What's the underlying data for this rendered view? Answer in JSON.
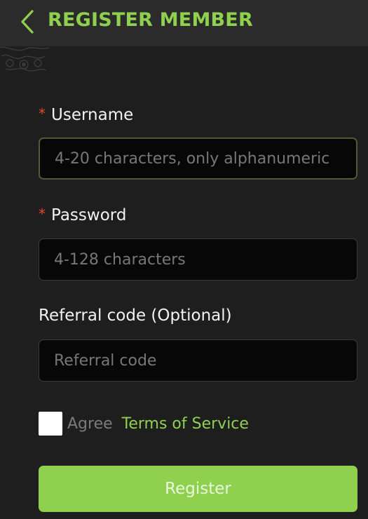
{
  "header": {
    "title": "REGISTER MEMBER",
    "back_icon": "chevron-left-icon"
  },
  "form": {
    "username": {
      "label": "Username",
      "required_mark": "*",
      "placeholder": "4-20 characters, only alphanumeric",
      "value": ""
    },
    "password": {
      "label": "Password",
      "required_mark": "*",
      "placeholder": "4-128 characters",
      "value": ""
    },
    "referral": {
      "label": "Referral code (Optional)",
      "placeholder": "Referral code",
      "value": ""
    },
    "agree": {
      "checked": false,
      "text": "Agree",
      "link": "Terms of Service"
    },
    "submit_label": "Register"
  },
  "colors": {
    "accent": "#8fd14f",
    "background": "#1e1e1e",
    "header": "#2a2b2a",
    "input": "#070707",
    "required": "#e5482d"
  }
}
